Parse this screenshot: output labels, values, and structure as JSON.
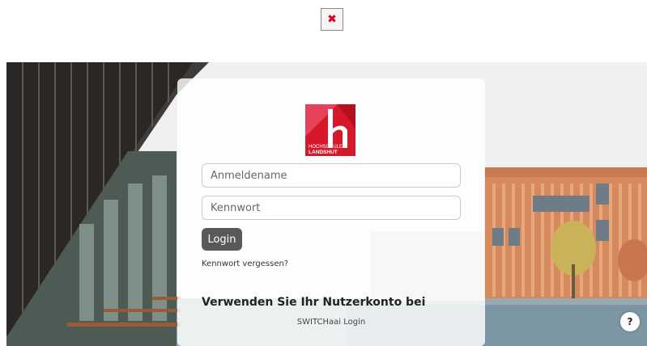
{
  "header": {
    "broken_image_icon": "broken-image-icon",
    "broken_image_glyph": "✖"
  },
  "brand": {
    "logo_line1": "HOCHSCHULE",
    "logo_line2": "LANDSHUT",
    "logo_letter": "h",
    "logo_color": "#d7182a"
  },
  "login_form": {
    "username_placeholder": "Anmeldename",
    "password_placeholder": "Kennwort",
    "login_label": "Login",
    "forgot_link": "Kennwort vergessen?",
    "button_color": "#595959"
  },
  "alternative_login": {
    "heading": "Verwenden Sie Ihr Nutzerkonto bei",
    "switch_link": "SWITCHaai Login"
  },
  "help": {
    "label": "?"
  }
}
